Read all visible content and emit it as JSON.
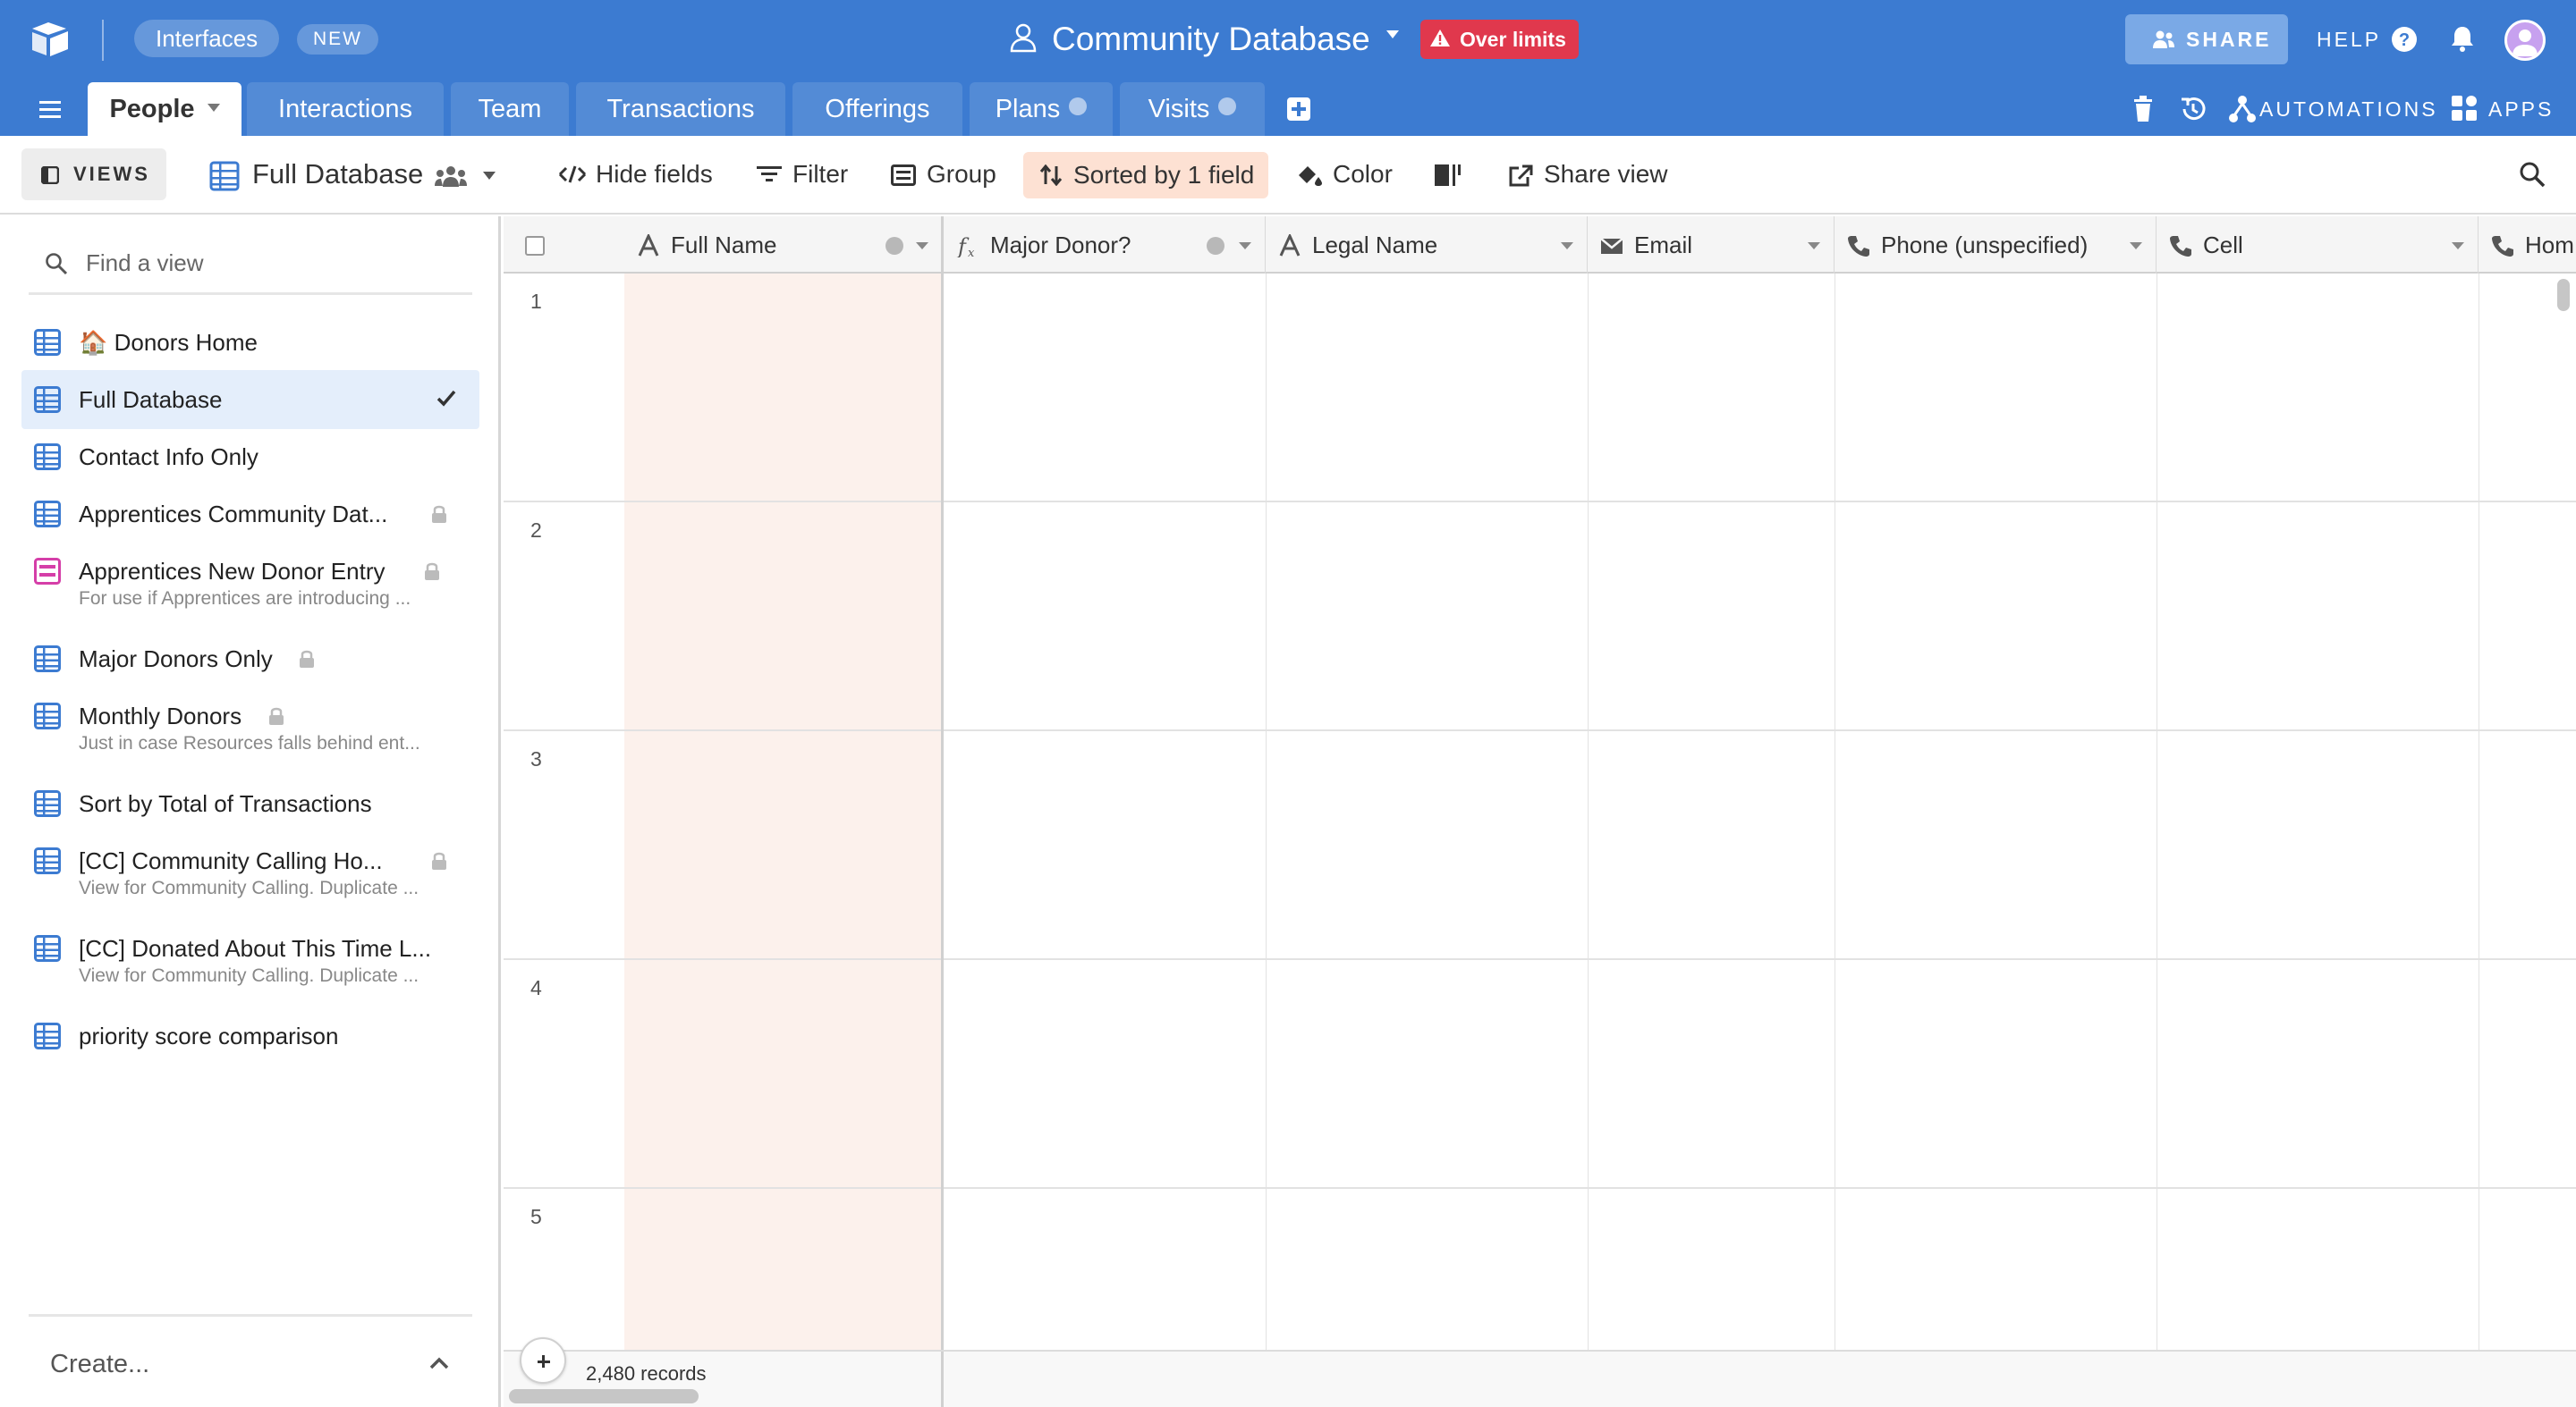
{
  "header": {
    "interfaces_label": "Interfaces",
    "new_badge": "NEW",
    "base_title": "Community Database",
    "over_limits": "Over limits",
    "share_label": "SHARE",
    "help_label": "HELP"
  },
  "tabs": [
    {
      "label": "People",
      "active": true
    },
    {
      "label": "Interactions"
    },
    {
      "label": "Team"
    },
    {
      "label": "Transactions"
    },
    {
      "label": "Offerings"
    },
    {
      "label": "Plans"
    },
    {
      "label": "Visits"
    }
  ],
  "toolbar_right": {
    "automations_label": "AUTOMATIONS",
    "apps_label": "APPS"
  },
  "viewbar": {
    "views_label": "VIEWS",
    "current_view": "Full Database",
    "hide_fields": "Hide fields",
    "filter": "Filter",
    "group": "Group",
    "sorted": "Sorted by 1 field",
    "color": "Color",
    "share_view": "Share view"
  },
  "sidebar": {
    "search_placeholder": "Find a view",
    "views": [
      {
        "label": "🏠 Donors Home",
        "icon": "grid-view-icon"
      },
      {
        "label": "Full Database",
        "icon": "grid-view-icon",
        "selected": true
      },
      {
        "label": "Contact Info Only",
        "icon": "grid-view-icon"
      },
      {
        "label": "Apprentices Community Dat...",
        "icon": "grid-view-icon",
        "locked": true
      },
      {
        "label": "Apprentices New Donor Entry",
        "desc": "For use if Apprentices are introducing ...",
        "icon": "form-view-icon",
        "locked": true
      },
      {
        "label": "Major Donors Only",
        "icon": "grid-view-icon",
        "locked": true
      },
      {
        "label": "Monthly Donors",
        "desc": "Just in case Resources falls behind ent...",
        "icon": "grid-view-icon",
        "locked": true
      },
      {
        "label": "Sort by Total of Transactions",
        "icon": "grid-view-icon"
      },
      {
        "label": "[CC] Community Calling Ho...",
        "desc": "View for Community Calling. Duplicate ...",
        "icon": "grid-view-icon",
        "locked": true
      },
      {
        "label": "[CC] Donated About This Time L...",
        "desc": "View for Community Calling. Duplicate ...",
        "icon": "grid-view-icon"
      },
      {
        "label": "priority score comparison",
        "icon": "grid-view-icon"
      }
    ],
    "create_label": "Create..."
  },
  "grid": {
    "columns": [
      {
        "label": "Full Name",
        "icon": "text-field-icon"
      },
      {
        "label": "Major Donor?",
        "icon": "formula-field-icon"
      },
      {
        "label": "Legal Name",
        "icon": "text-field-icon"
      },
      {
        "label": "Email",
        "icon": "email-field-icon"
      },
      {
        "label": "Phone (unspecified)",
        "icon": "phone-field-icon"
      },
      {
        "label": "Cell",
        "icon": "phone-field-icon"
      },
      {
        "label": "Hom",
        "icon": "phone-field-icon"
      }
    ],
    "rows": [
      "1",
      "2",
      "3",
      "4",
      "5"
    ],
    "records_count": "2,480 records"
  },
  "colors": {
    "brand_blue": "#3c7bd1",
    "over_limits_red": "#e0384d",
    "sorted_highlight": "#fde1d3",
    "primary_column_tint": "#fcf1ec",
    "selected_view": "#e4eefb",
    "form_view_pink": "#d53ea8"
  }
}
